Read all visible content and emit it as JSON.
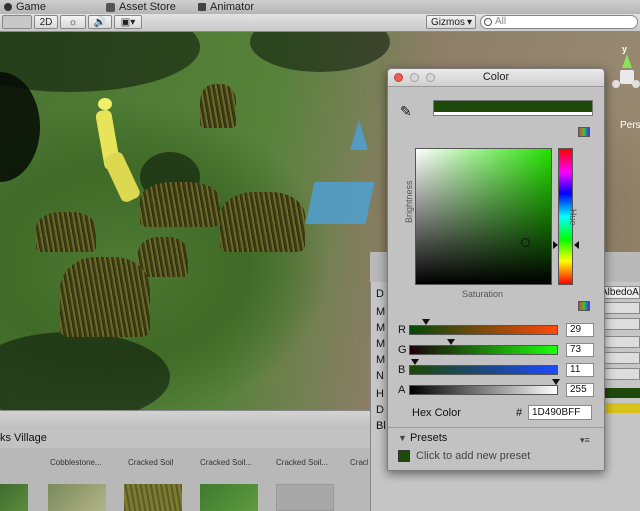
{
  "tabs": [
    {
      "label": "Game",
      "icon": "game-icon"
    },
    {
      "label": "Asset Store",
      "icon": "store-icon"
    },
    {
      "label": "Animator",
      "icon": "animator-icon"
    }
  ],
  "toolbar": {
    "mode_2d": "2D",
    "gizmos_label": "Gizmos",
    "search_text": "All",
    "persp_label": "Pers"
  },
  "color_window": {
    "title": "Color",
    "current_color": "#1D490B",
    "brightness_label": "Brightness",
    "saturation_label": "Saturation",
    "hue_label": "Hue",
    "channels": [
      {
        "label": "R",
        "value": "29",
        "fraction": 0.114
      },
      {
        "label": "G",
        "value": "73",
        "fraction": 0.286
      },
      {
        "label": "B",
        "value": "11",
        "fraction": 0.043
      },
      {
        "label": "A",
        "value": "255",
        "fraction": 1.0
      }
    ],
    "hex_label": "Hex Color",
    "hex_prefix": "#",
    "hex_value": "1D490BFF",
    "presets_label": "Presets",
    "add_preset_text": "Click to add new preset"
  },
  "inspector": {
    "labels": [
      "D",
      "M",
      "M",
      "M",
      "M",
      "N",
      "H",
      "D",
      "Bl"
    ],
    "albedo_field": "AlbedoA"
  },
  "project": {
    "breadcrumb": "ks Village",
    "assets": [
      "Cobblestone...",
      "Cracked Soil",
      "Cracked Soil...",
      "Cracked Soil...",
      "Cracked Soi..."
    ]
  }
}
